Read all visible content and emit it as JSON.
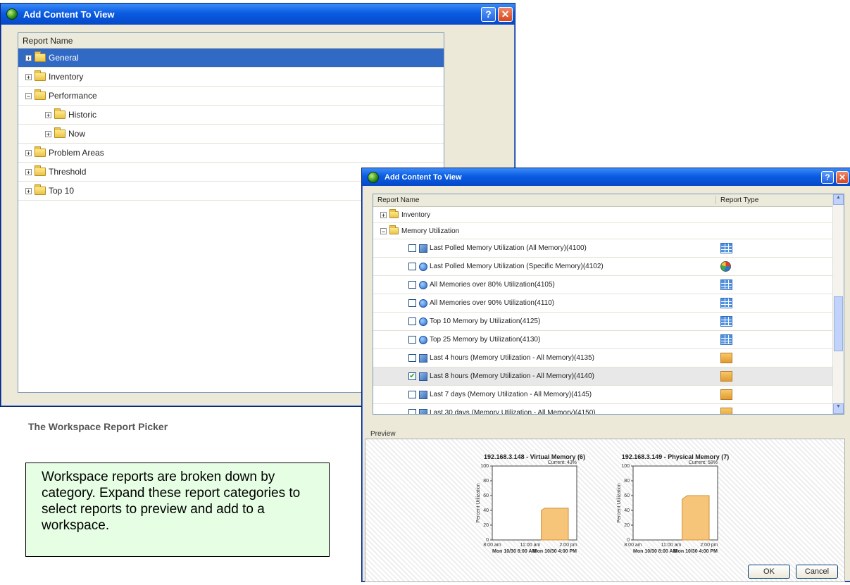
{
  "left_window": {
    "title": "Add Content To View",
    "header": "Report Name",
    "tree": [
      {
        "label": "General",
        "toggle": "+",
        "level": 0,
        "selected": true
      },
      {
        "label": "Inventory",
        "toggle": "+",
        "level": 0
      },
      {
        "label": "Performance",
        "toggle": "−",
        "level": 0
      },
      {
        "label": "Historic",
        "toggle": "+",
        "level": 1
      },
      {
        "label": "Now",
        "toggle": "+",
        "level": 1
      },
      {
        "label": "Problem Areas",
        "toggle": "+",
        "level": 0
      },
      {
        "label": "Threshold",
        "toggle": "+",
        "level": 0
      },
      {
        "label": "Top 10",
        "toggle": "+",
        "level": 0
      }
    ]
  },
  "caption": "The Workspace Report Picker",
  "note": "Workspace reports are broken down by category. Expand these report categories to select reports to preview and add to a workspace.",
  "right_window": {
    "title": "Add Content To View",
    "col_name": "Report Name",
    "col_type": "Report Type",
    "folders": [
      {
        "label": "Inventory",
        "toggle": "+"
      },
      {
        "label": "Memory Utilization",
        "toggle": "−"
      }
    ],
    "reports": [
      {
        "label": "Last Polled Memory Utilization (All Memory)(4100)",
        "icon": "doc-icon",
        "type": "table",
        "checked": false
      },
      {
        "label": "Last Polled Memory Utilization (Specific Memory)(4102)",
        "icon": "globe-icon",
        "type": "pie",
        "checked": false
      },
      {
        "label": "All Memories over 80% Utilization(4105)",
        "icon": "globe-icon",
        "type": "table",
        "checked": false
      },
      {
        "label": "All Memories over 90% Utilization(4110)",
        "icon": "globe-icon",
        "type": "table",
        "checked": false
      },
      {
        "label": "Top 10 Memory by Utilization(4125)",
        "icon": "globe-icon",
        "type": "table",
        "checked": false
      },
      {
        "label": "Top 25 Memory by Utilization(4130)",
        "icon": "globe-icon",
        "type": "table",
        "checked": false
      },
      {
        "label": "Last 4 hours (Memory Utilization - All Memory)(4135)",
        "icon": "doc-icon",
        "type": "area",
        "checked": false
      },
      {
        "label": "Last 8 hours (Memory Utilization - All Memory)(4140)",
        "icon": "doc-icon",
        "type": "area",
        "checked": true
      },
      {
        "label": "Last 7 days (Memory Utilization - All Memory)(4145)",
        "icon": "doc-icon",
        "type": "area",
        "checked": false
      },
      {
        "label": "Last 30 days (Memory Utilization - All Memory)(4150)",
        "icon": "doc-icon",
        "type": "area",
        "checked": false
      }
    ],
    "preview_label": "Preview",
    "ok_label": "OK",
    "cancel_label": "Cancel"
  },
  "chart_data": [
    {
      "type": "area",
      "title": "192.168.3.148 - Virtual Memory (6)",
      "subtitle": "Current: 43%",
      "ylabel": "Percent Utilization",
      "ylim": [
        0,
        100
      ],
      "yticks": [
        "0",
        "20",
        "40",
        "60",
        "80",
        "100"
      ],
      "xticks": [
        "8:00 am",
        "11:00 am",
        "2:00 pm"
      ],
      "xrange": [
        "Mon 10/30 8:00 AM",
        "Mon 10/30 4:00 PM"
      ],
      "series": [
        {
          "x": [
            0.58,
            0.62,
            0.9
          ],
          "values": [
            40,
            43,
            43
          ]
        }
      ]
    },
    {
      "type": "area",
      "title": "192.168.3.149 - Physical Memory (7)",
      "subtitle": "Current: 58%",
      "ylabel": "Percent Utilization",
      "ylim": [
        0,
        100
      ],
      "yticks": [
        "0",
        "20",
        "40",
        "60",
        "80",
        "100"
      ],
      "xticks": [
        "8:00 am",
        "11:00 am",
        "2:00 pm"
      ],
      "xrange": [
        "Mon 10/30 8:00 AM",
        "Mon 10/30 4:00 PM"
      ],
      "series": [
        {
          "x": [
            0.58,
            0.64,
            0.9
          ],
          "values": [
            55,
            60,
            60
          ]
        }
      ]
    }
  ]
}
